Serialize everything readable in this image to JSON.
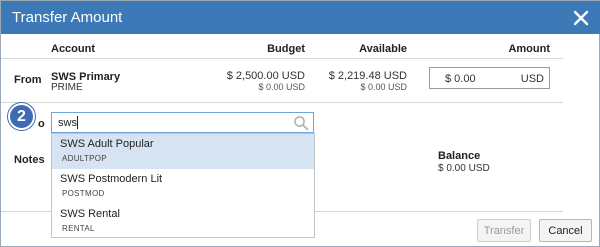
{
  "dialog": {
    "title": "Transfer Amount",
    "close_icon": "close-icon"
  },
  "columns": {
    "account": "Account",
    "budget": "Budget",
    "available": "Available",
    "amount": "Amount"
  },
  "from": {
    "label": "From",
    "account_name": "SWS Primary",
    "account_code": "PRIME",
    "budget": "$ 2,500.00 USD",
    "budget_sub": "$ 0.00 USD",
    "available": "$ 2,219.48 USD",
    "available_sub": "$ 0.00 USD",
    "amount_value": "$ 0.00",
    "amount_currency": "USD"
  },
  "to": {
    "step_number": "2",
    "label_fragment": "o",
    "search_value": "sws",
    "search_icon": "search-icon",
    "options": [
      {
        "name": "SWS Adult Popular",
        "code": "ADULTPOP",
        "selected": true
      },
      {
        "name": "SWS Postmodern Lit",
        "code": "POSTMOD",
        "selected": false
      },
      {
        "name": "SWS Rental",
        "code": "RENTAL",
        "selected": false
      }
    ]
  },
  "notes": {
    "label": "Notes",
    "balance_label": "Balance",
    "balance_value": "$ 0.00 USD"
  },
  "footer": {
    "transfer_label": "Transfer",
    "cancel_label": "Cancel"
  },
  "colors": {
    "titlebar": "#3d78b7",
    "badge": "#3f6bb4",
    "selected_option": "#d6e3f3"
  }
}
